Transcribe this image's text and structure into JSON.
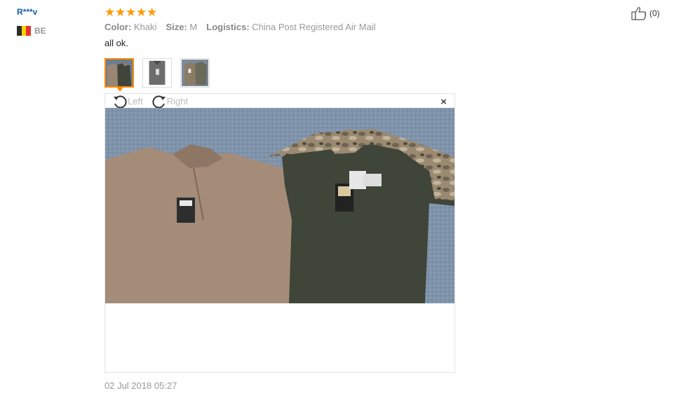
{
  "user": {
    "name": "R***v",
    "country_code": "BE",
    "flag_colors": [
      "#2d2d2d",
      "#f5d000",
      "#e8322d"
    ]
  },
  "feedback": {
    "rating": 5,
    "star_color": "#ff9a00",
    "attributes": [
      {
        "label": "Color:",
        "value": "Khaki"
      },
      {
        "label": "Size:",
        "value": "M"
      },
      {
        "label": "Logistics:",
        "value": "China Post Registered Air Mail"
      }
    ],
    "text": "all ok.",
    "date": "02 Jul 2018 05:27"
  },
  "images": {
    "thumbnails": [
      {
        "name": "photo-1",
        "active": true
      },
      {
        "name": "photo-2",
        "active": false
      },
      {
        "name": "photo-3",
        "active": false
      }
    ]
  },
  "viewer": {
    "rotate_left_label": "Left",
    "rotate_right_label": "Right",
    "close_symbol": "×"
  },
  "helpful": {
    "count_text": "(0)",
    "icon": "thumb-up-icon"
  }
}
